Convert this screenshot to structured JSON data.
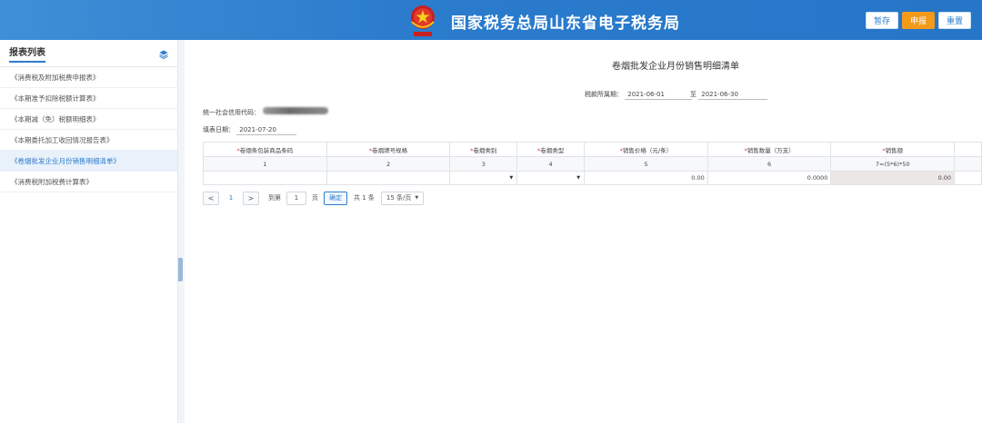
{
  "header": {
    "site_title": "国家税务总局山东省电子税务局",
    "buttons": {
      "save": "暂存",
      "submit": "申报",
      "reset": "重置"
    }
  },
  "sidebar": {
    "title": "报表列表",
    "items": [
      {
        "label": "《消费税及附加税费申报表》"
      },
      {
        "label": "《本期准予扣除税额计算表》"
      },
      {
        "label": "《本期减（免）税额明细表》"
      },
      {
        "label": "《本期委托加工收回情况报告表》"
      },
      {
        "label": "《卷烟批发企业月份销售明细清单》",
        "active": true
      },
      {
        "label": "《消费税附加税费计算表》"
      }
    ]
  },
  "form": {
    "title": "卷烟批发企业月份销售明细清单",
    "period_label": "税款所属期：",
    "period_start": "2021-06-01",
    "period_to": "至",
    "period_end": "2021-06-30",
    "credit_code_label": "统一社会信用代码：",
    "fill_date_label": "填表日期：",
    "fill_date": "2021-07-20"
  },
  "table": {
    "headers": [
      "卷烟条包装商品条码",
      "卷烟牌号规格",
      "卷烟类别",
      "卷烟类型",
      "销售价格（元/条）",
      "销售数量（万支）",
      "销售额"
    ],
    "indices": [
      "1",
      "2",
      "3",
      "4",
      "5",
      "6",
      "7=(5*6)*50"
    ],
    "row": {
      "price": "0.00",
      "quantity": "0.0000",
      "amount": "0.00"
    }
  },
  "pager": {
    "prev": "<",
    "current": "1",
    "next": ">",
    "goto_label": "到第",
    "goto_value": "1",
    "page_unit": "页",
    "confirm": "确定",
    "total": "共 1 条",
    "page_size": "15 条/页"
  },
  "colors": {
    "header_blue": "#2b7ccd",
    "submit_orange": "#f39a1a",
    "required_red": "#e03b3b"
  }
}
